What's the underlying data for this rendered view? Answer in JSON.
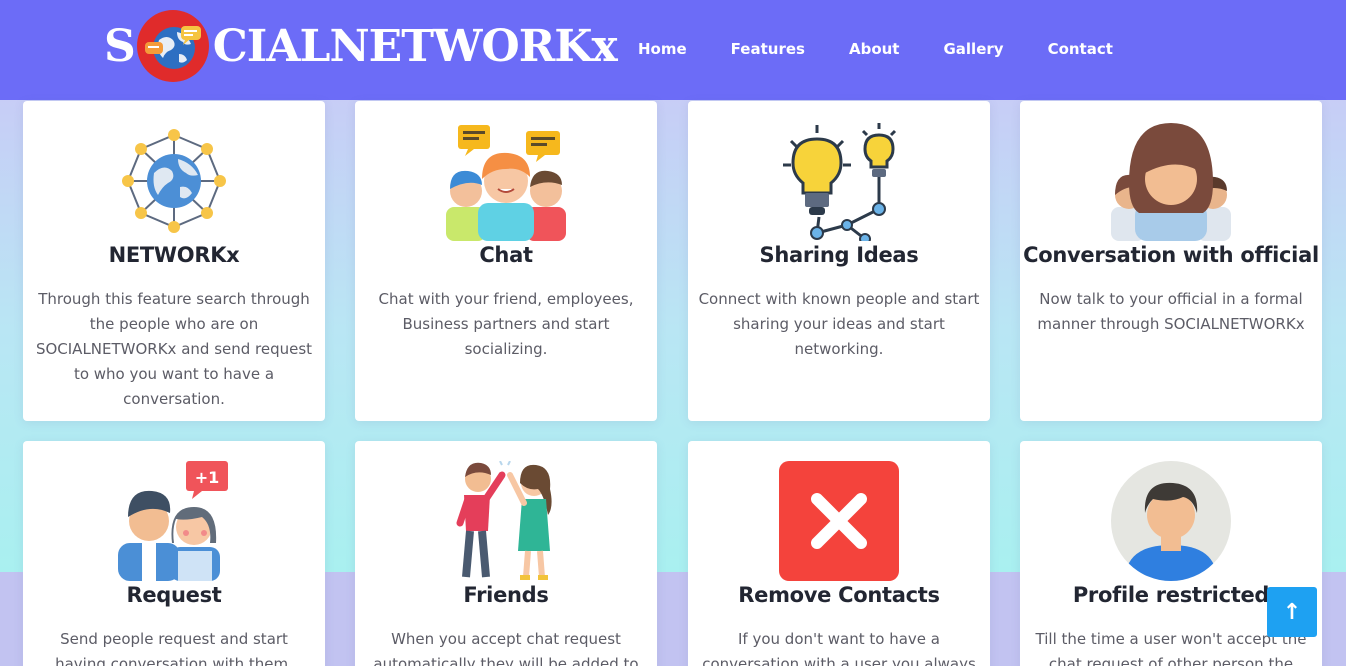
{
  "brand": {
    "prefix": "S",
    "suffix": "CIALNETWORKx"
  },
  "nav": [
    "Home",
    "Features",
    "About",
    "Gallery",
    "Contact"
  ],
  "features": [
    {
      "title": "NETWORKx",
      "text": "Through this feature search through the people who are on SOCIALNETWORKx and send request to who you want to have a conversation.",
      "icon": "network-globe-icon"
    },
    {
      "title": "Chat",
      "text": "Chat with your friend, employees, Business partners and start socializing.",
      "icon": "group-chat-icon"
    },
    {
      "title": "Sharing Ideas",
      "text": "Connect with known people and start sharing your ideas and start networking.",
      "icon": "lightbulb-idea-icon"
    },
    {
      "title": "Conversation with official",
      "text": "Now talk to your official in a formal manner through SOCIALNETWORKx",
      "icon": "officials-icon"
    },
    {
      "title": "Request",
      "text": "Send people request and start having conversation with them.",
      "icon": "friend-request-icon"
    },
    {
      "title": "Friends",
      "text": "When you accept chat request automatically they will be added to",
      "icon": "high-five-friends-icon"
    },
    {
      "title": "Remove Contacts",
      "text": "If you don't want to have a conversation with a user you always",
      "icon": "remove-x-icon"
    },
    {
      "title": "Profile restricted",
      "text": "Till the time a user won't accept the chat request of other person the",
      "icon": "profile-avatar-icon"
    }
  ],
  "scroll_top": {
    "label": "↑",
    "icon": "arrow-up-icon"
  },
  "colors": {
    "navbar": "#6c6cf7",
    "logo_globe": "#e02b2b",
    "remove_red": "#f4433c",
    "scroll_button": "#1ea1f2"
  }
}
